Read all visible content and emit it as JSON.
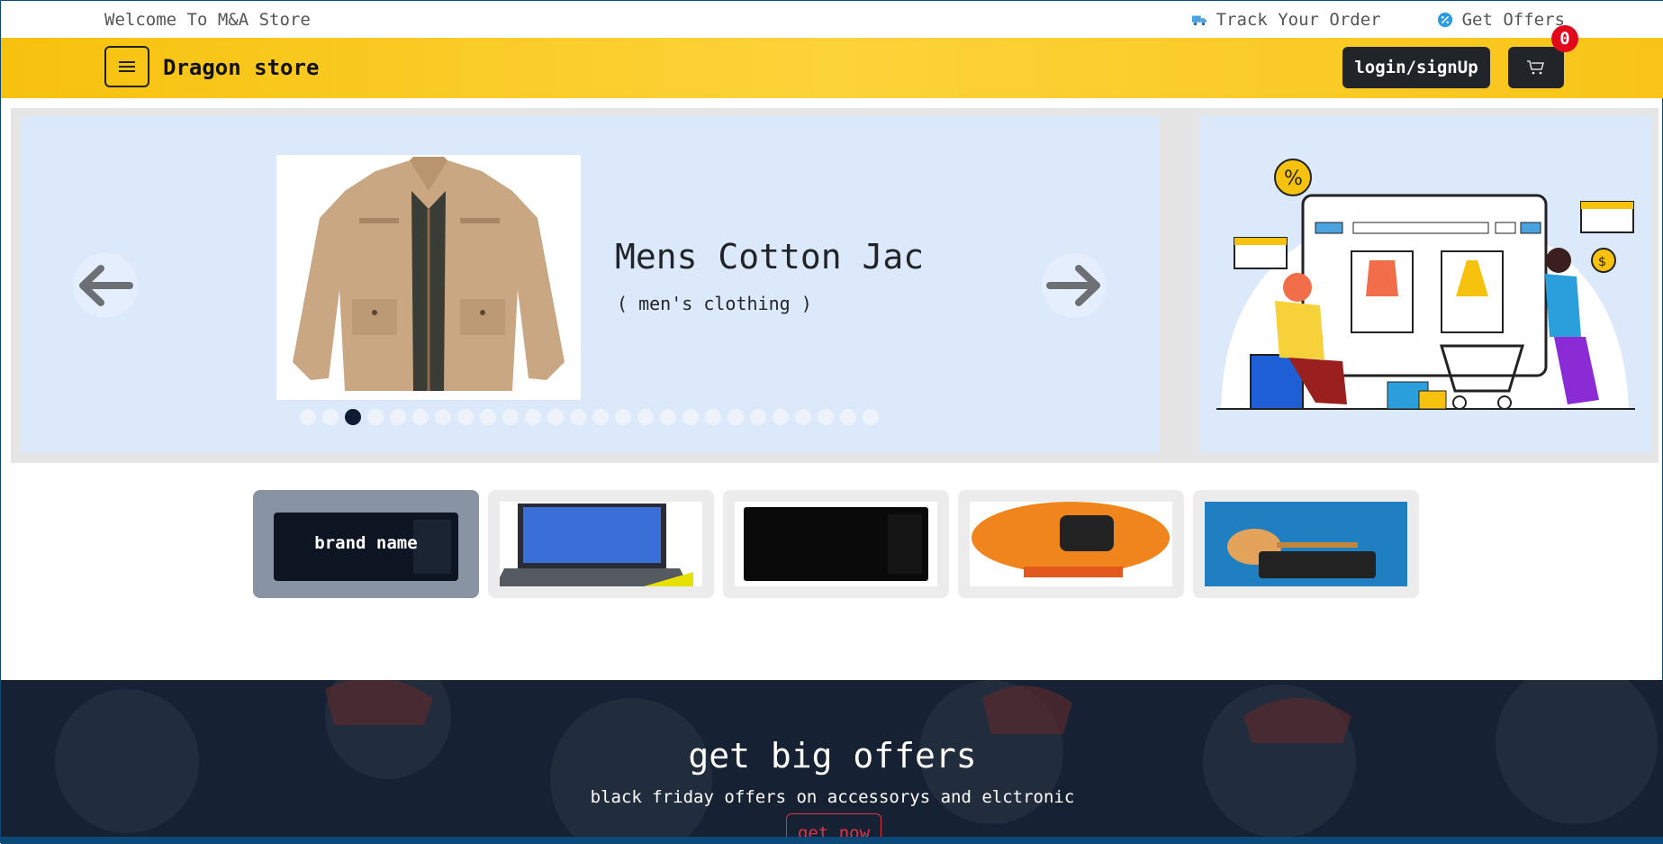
{
  "topbar": {
    "welcome": "Welcome To M&A Store",
    "track_order": "Track Your Order",
    "get_offers": "Get Offers"
  },
  "header": {
    "brand": "Dragon store",
    "login_label": "login/signUp",
    "cart_count": "0"
  },
  "carousel": {
    "title": "Mens Cotton Jac",
    "category": "( men's clothing )",
    "total_slides": 26,
    "active_index": 2
  },
  "brands": {
    "hover_label": "brand name",
    "items": [
      "microwave",
      "laptop",
      "microwave-black",
      "electronics-offer",
      "guitar-audio"
    ]
  },
  "offers": {
    "title": "get big offers",
    "subtitle": "black friday offers on accessorys and elctronic",
    "button": "get now"
  },
  "colors": {
    "header_yellow": "#fcc92b",
    "dark": "#212529",
    "badge_red": "#e1081b",
    "slider_bg": "#dce9fb",
    "offers_bg": "#162233"
  }
}
